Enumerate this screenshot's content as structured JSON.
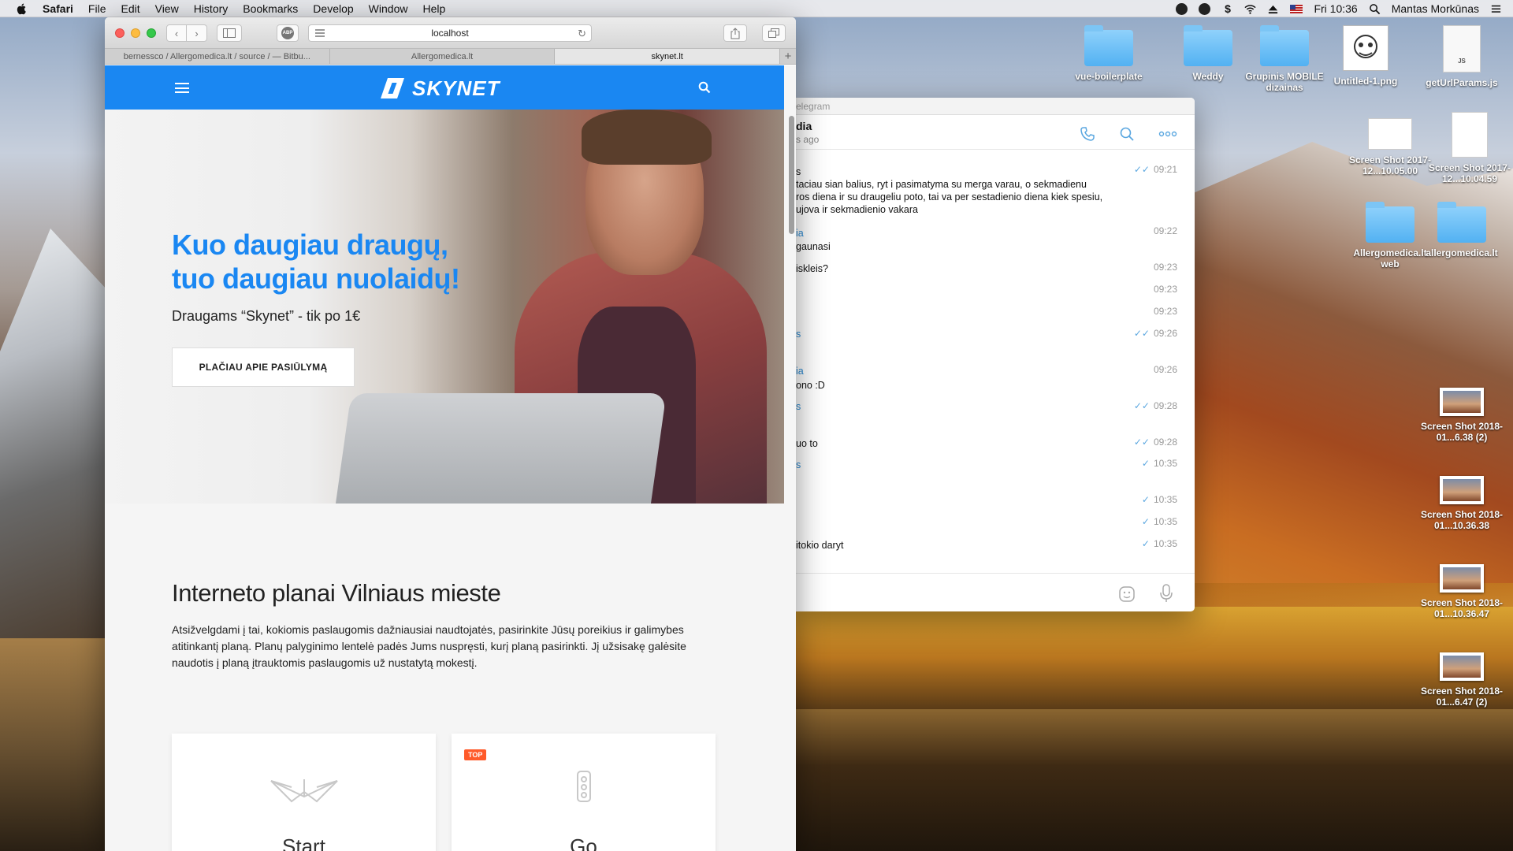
{
  "menubar": {
    "items": [
      "Safari",
      "File",
      "Edit",
      "View",
      "History",
      "Bookmarks",
      "Develop",
      "Window",
      "Help"
    ],
    "clock": "Fri 10:36",
    "user": "Mantas Morkūnas"
  },
  "safari": {
    "url": "localhost",
    "abp_label": "ABP",
    "tabs": [
      {
        "label": "bernessco / Allergomedica.lt / source / — Bitbu..."
      },
      {
        "label": "Allergomedica.lt"
      },
      {
        "label": "skynet.lt"
      }
    ],
    "new_tab": "+"
  },
  "site": {
    "logo_text": "SKYNET",
    "hero": {
      "title_line1": "Kuo daugiau draugų,",
      "title_line2": "tuo daugiau nuolaidų!",
      "subtitle": "Draugams “Skynet” - tik po 1€",
      "button": "PLAČIAU APIE PASIŪLYMĄ"
    },
    "plans": {
      "title": "Interneto planai Vilniaus mieste",
      "description": "Atsižvelgdami į tai, kokiomis paslaugomis dažniausiai naudtojatės, pasirinkite Jūsų poreikius ir galimybes atitinkantį planą. Planų palyginimo lentelė padės Jums nuspręsti, kurį planą pasirinkti. Jį užsisakę galėsite naudotis į planą įtrauktomis paslaugomis už nustatytą mokestį.",
      "cards": [
        {
          "name": "Start",
          "badge": ""
        },
        {
          "name": "Go",
          "badge": "TOP"
        }
      ]
    }
  },
  "telegram": {
    "title": "elegram",
    "chat_name": "dia",
    "chat_status": "s ago",
    "messages": [
      {
        "sender": "",
        "lines": [
          "s",
          "taciau sian balius, ryt i pasimatyma su merga varau, o sekmadienu",
          "ros diena ir su draugeliu poto, tai va per sestadienio diena kiek spesiu,",
          "ujova ir sekmadienio vakara"
        ],
        "time": "09:21",
        "ticks": "✓✓"
      },
      {
        "sender": "ia",
        "lines": [
          "gaunasi"
        ],
        "time": "09:22",
        "ticks": ""
      },
      {
        "sender": "",
        "lines": [
          "iskleis?"
        ],
        "time": "09:23",
        "ticks": ""
      },
      {
        "sender": "",
        "lines": [
          ""
        ],
        "time": "09:23",
        "ticks": ""
      },
      {
        "sender": "",
        "lines": [
          ""
        ],
        "time": "09:23",
        "ticks": ""
      },
      {
        "sender": "s",
        "lines": [
          ""
        ],
        "time": "09:26",
        "ticks": "✓✓"
      },
      {
        "sender": "ia",
        "lines": [
          "ono :D"
        ],
        "time": "09:26",
        "ticks": ""
      },
      {
        "sender": "s",
        "lines": [
          ""
        ],
        "time": "09:28",
        "ticks": "✓✓"
      },
      {
        "sender": "",
        "lines": [
          "uo to"
        ],
        "time": "09:28",
        "ticks": "✓✓"
      },
      {
        "sender": "s",
        "lines": [
          ""
        ],
        "time": "10:35",
        "ticks": "✓"
      },
      {
        "sender": "",
        "lines": [
          ""
        ],
        "time": "10:35",
        "ticks": "✓"
      },
      {
        "sender": "",
        "lines": [
          ""
        ],
        "time": "10:35",
        "ticks": "✓"
      },
      {
        "sender": "",
        "lines": [
          "itokio daryt"
        ],
        "time": "10:35",
        "ticks": "✓"
      }
    ]
  },
  "desktop": {
    "icons": [
      {
        "label": "vue-boilerplate",
        "kind": "folder"
      },
      {
        "label": "Weddy",
        "kind": "folder"
      },
      {
        "label": "Grupinis MOBILE dizainas",
        "kind": "folder"
      },
      {
        "label": "Untitled-1.png",
        "kind": "png"
      },
      {
        "label": "getUrlParams.js",
        "kind": "js",
        "badge": "JS"
      },
      {
        "label": "Screen Shot 2017-12...10.05.00",
        "kind": "shot"
      },
      {
        "label": "Screen Shot 2017-12...10.04.59",
        "kind": "shot"
      },
      {
        "label": "Allergomedica.lt web",
        "kind": "folder"
      },
      {
        "label": "allergomedica.lt",
        "kind": "folder"
      },
      {
        "label": "Screen Shot 2018-01...6.38 (2)",
        "kind": "thumb"
      },
      {
        "label": "Screen Shot 2018-01...10.36.38",
        "kind": "thumb"
      },
      {
        "label": "Screen Shot 2018-01...10.36.47",
        "kind": "thumb"
      },
      {
        "label": "Screen Shot 2018-01...6.47 (2)",
        "kind": "thumb"
      }
    ]
  }
}
